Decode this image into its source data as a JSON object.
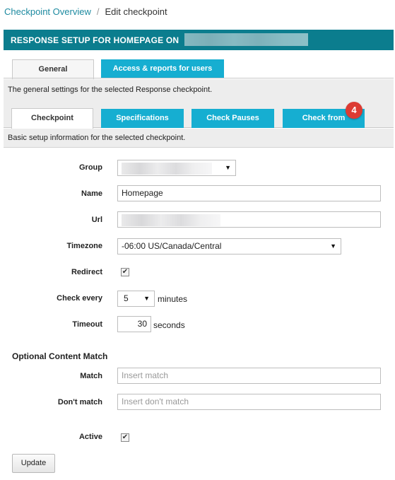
{
  "breadcrumb": {
    "parent": "Checkpoint Overview",
    "separator": "/",
    "current": "Edit checkpoint"
  },
  "panel": {
    "title": "RESPONSE SETUP FOR HOMEPAGE ON"
  },
  "top_tabs": [
    {
      "label": "General",
      "active": true
    },
    {
      "label": "Access & reports for users",
      "active": false
    }
  ],
  "general_description": "The general settings for the selected Response checkpoint.",
  "sub_tabs": [
    {
      "label": "Checkpoint",
      "active": true
    },
    {
      "label": "Specifications",
      "active": false
    },
    {
      "label": "Check Pauses",
      "active": false
    },
    {
      "label": "Check from",
      "active": false
    }
  ],
  "badge": {
    "count": "4",
    "color": "#dc3b33"
  },
  "checkpoint_description": "Basic setup information for the selected checkpoint.",
  "form": {
    "group": {
      "label": "Group",
      "value": ""
    },
    "name": {
      "label": "Name",
      "value": "Homepage"
    },
    "url": {
      "label": "Url",
      "value": ""
    },
    "timezone": {
      "label": "Timezone",
      "value": "-06:00 US/Canada/Central"
    },
    "redirect": {
      "label": "Redirect",
      "checked": true
    },
    "check_every": {
      "label": "Check every",
      "value": "5",
      "unit": "minutes"
    },
    "timeout": {
      "label": "Timeout",
      "value": "30",
      "unit": "seconds"
    }
  },
  "optional": {
    "title": "Optional Content Match",
    "match": {
      "label": "Match",
      "placeholder": "Insert match"
    },
    "dont_match": {
      "label": "Don't match",
      "placeholder": "Insert don't match"
    }
  },
  "active": {
    "label": "Active",
    "checked": true
  },
  "update_button": "Update",
  "colors": {
    "header": "#0b7d8e",
    "tab_inactive": "#16aed1",
    "link": "#1d8aa0"
  }
}
